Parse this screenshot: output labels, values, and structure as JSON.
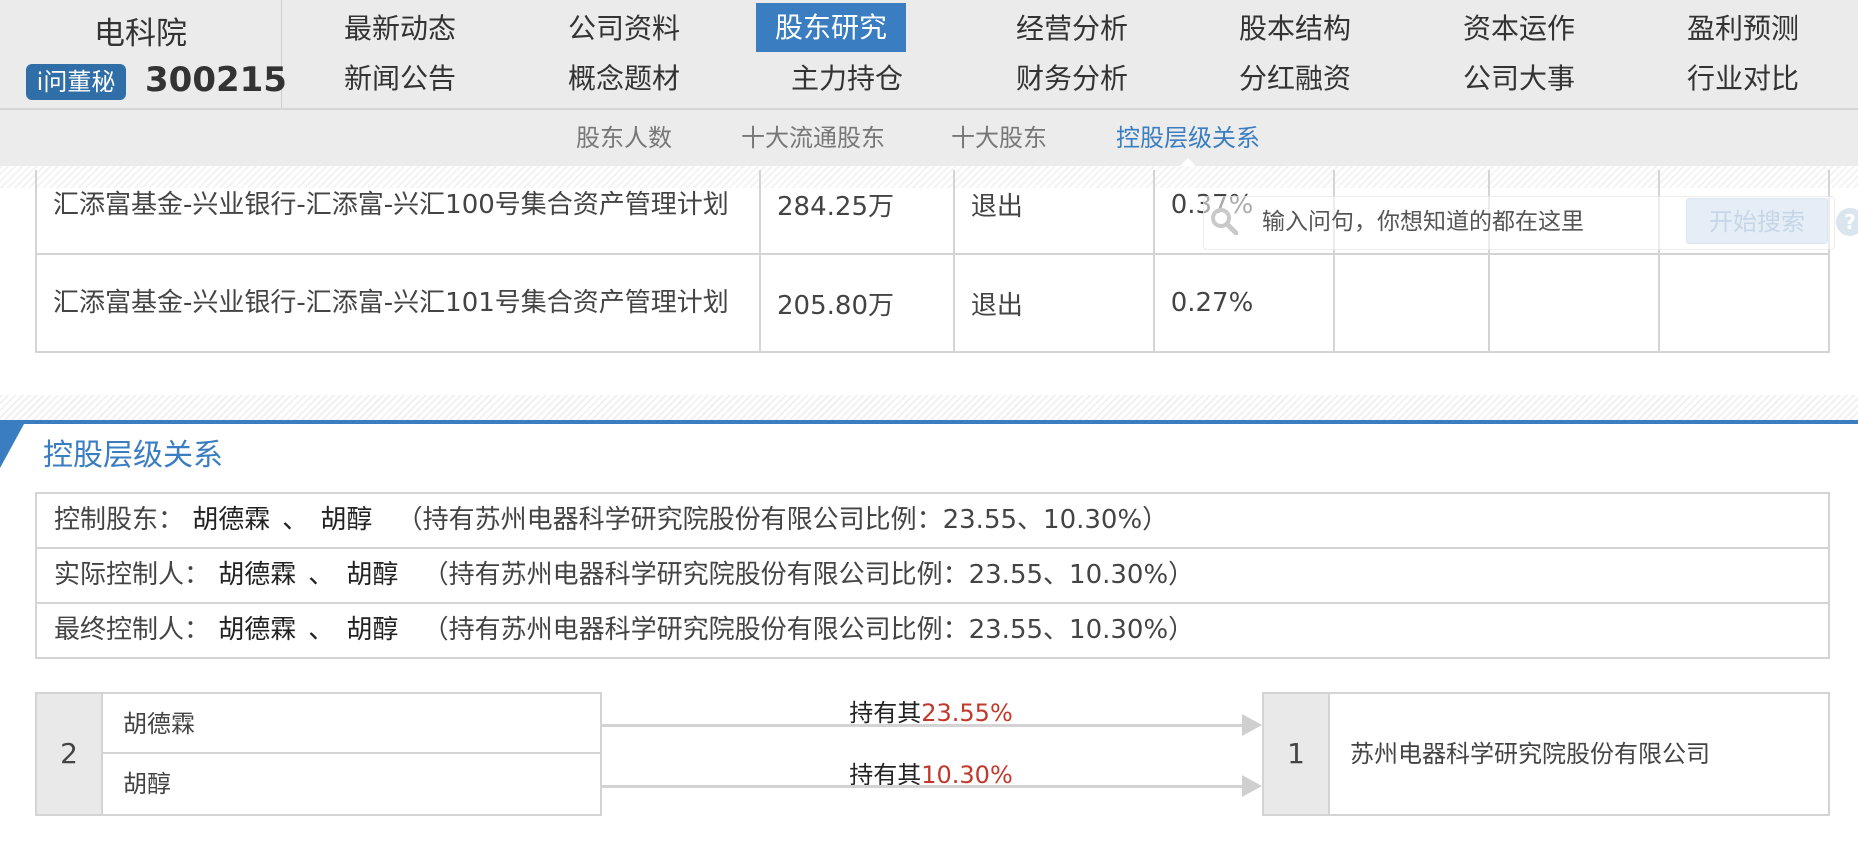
{
  "header": {
    "stock_name": "电科院",
    "wen_badge": "i问董秘",
    "stock_code": "300215",
    "nav_row1": [
      "最新动态",
      "公司资料",
      "股东研究",
      "经营分析",
      "股本结构",
      "资本运作",
      "盈利预测"
    ],
    "nav_row2": [
      "新闻公告",
      "概念题材",
      "主力持仓",
      "财务分析",
      "分红融资",
      "公司大事",
      "行业对比"
    ],
    "active_nav": "股东研究"
  },
  "subnav": {
    "items": [
      "股东人数",
      "十大流通股东",
      "十大股东",
      "控股层级关系"
    ],
    "active": "控股层级关系"
  },
  "search": {
    "placeholder": "输入问句，你想知道的都在这里",
    "button": "开始搜索",
    "help": "?"
  },
  "top_table": {
    "rows": [
      {
        "name": "汇添富基金-兴业银行-汇添富-兴汇100号集合资产管理计划",
        "shares": "284.25万",
        "change": "退出",
        "ratio": "0.37%"
      },
      {
        "name": "汇添富基金-兴业银行-汇添富-兴汇101号集合资产管理计划",
        "shares": "205.80万",
        "change": "退出",
        "ratio": "0.27%"
      }
    ]
  },
  "section": {
    "title": "控股层级关系"
  },
  "control": {
    "sep": "、",
    "rows": [
      {
        "label": "控制股东：",
        "person1": "胡德霖",
        "person2": "胡醇",
        "detail": "（持有苏州电器科学研究院股份有限公司比例：23.55、10.30%）"
      },
      {
        "label": "实际控制人：",
        "person1": "胡德霖",
        "person2": "胡醇",
        "detail": "（持有苏州电器科学研究院股份有限公司比例：23.55、10.30%）"
      },
      {
        "label": "最终控制人：",
        "person1": "胡德霖",
        "person2": "胡醇",
        "detail": "（持有苏州电器科学研究院股份有限公司比例：23.55、10.30%）"
      }
    ]
  },
  "diagram": {
    "left_count": "2",
    "holders": [
      "胡德霖",
      "胡醇"
    ],
    "hold_prefix": "持有其",
    "percents": [
      "23.55%",
      "10.30%"
    ],
    "right_count": "1",
    "company": "苏州电器科学研究院股份有限公司"
  }
}
